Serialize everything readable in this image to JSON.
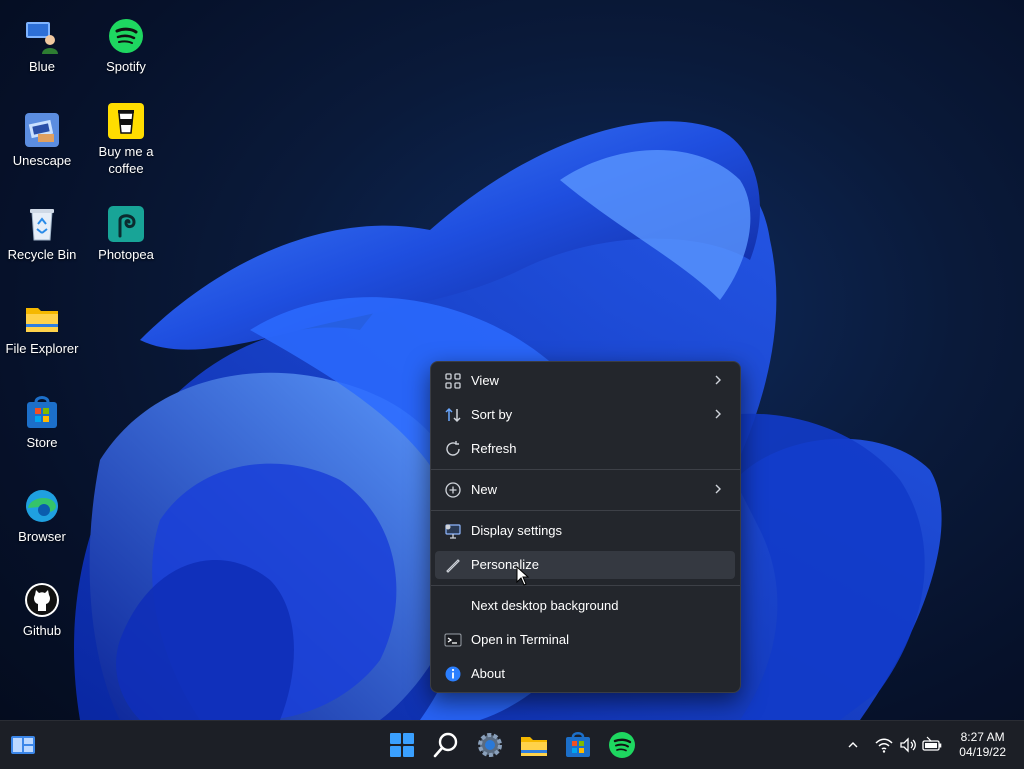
{
  "desktop": {
    "icons": [
      {
        "label": "Blue",
        "icon": "blue-user-icon"
      },
      {
        "label": "Spotify",
        "icon": "spotify-icon"
      },
      {
        "label": "Unescape",
        "icon": "unescape-icon"
      },
      {
        "label": "Buy me a coffee",
        "icon": "coffee-icon"
      },
      {
        "label": "Recycle Bin",
        "icon": "recycle-bin-icon"
      },
      {
        "label": "Photopea",
        "icon": "photopea-icon"
      },
      {
        "label": "File Explorer",
        "icon": "folder-icon"
      },
      {
        "label": "Store",
        "icon": "store-icon"
      },
      {
        "label": "Browser",
        "icon": "edge-icon"
      },
      {
        "label": "Github",
        "icon": "github-icon"
      }
    ]
  },
  "context_menu": {
    "items": [
      {
        "label": "View",
        "icon": "grid-icon",
        "submenu": true
      },
      {
        "label": "Sort by",
        "icon": "sort-icon",
        "submenu": true
      },
      {
        "label": "Refresh",
        "icon": "refresh-icon",
        "submenu": false
      },
      {
        "label": "New",
        "icon": "plus-circle-icon",
        "submenu": true
      },
      {
        "label": "Display settings",
        "icon": "display-icon",
        "submenu": false
      },
      {
        "label": "Personalize",
        "icon": "pen-icon",
        "submenu": false,
        "hovered": true
      },
      {
        "label": "Next desktop background",
        "icon": "",
        "submenu": false
      },
      {
        "label": "Open in Terminal",
        "icon": "terminal-icon",
        "submenu": false
      },
      {
        "label": "About",
        "icon": "info-icon",
        "submenu": false
      }
    ]
  },
  "taskbar": {
    "left_widget": "widgets-icon",
    "center": [
      "start-icon",
      "search-icon",
      "settings-icon",
      "file-explorer-icon",
      "store-icon",
      "spotify-icon"
    ],
    "tray": [
      "chevron-up-icon",
      "wifi-icon",
      "volume-icon",
      "battery-icon"
    ],
    "time": "8:27 AM",
    "date": "04/19/22"
  },
  "colors": {
    "accent": "#1f5fff",
    "menu_bg": "#23262c",
    "taskbar_bg": "#1c1f26"
  }
}
